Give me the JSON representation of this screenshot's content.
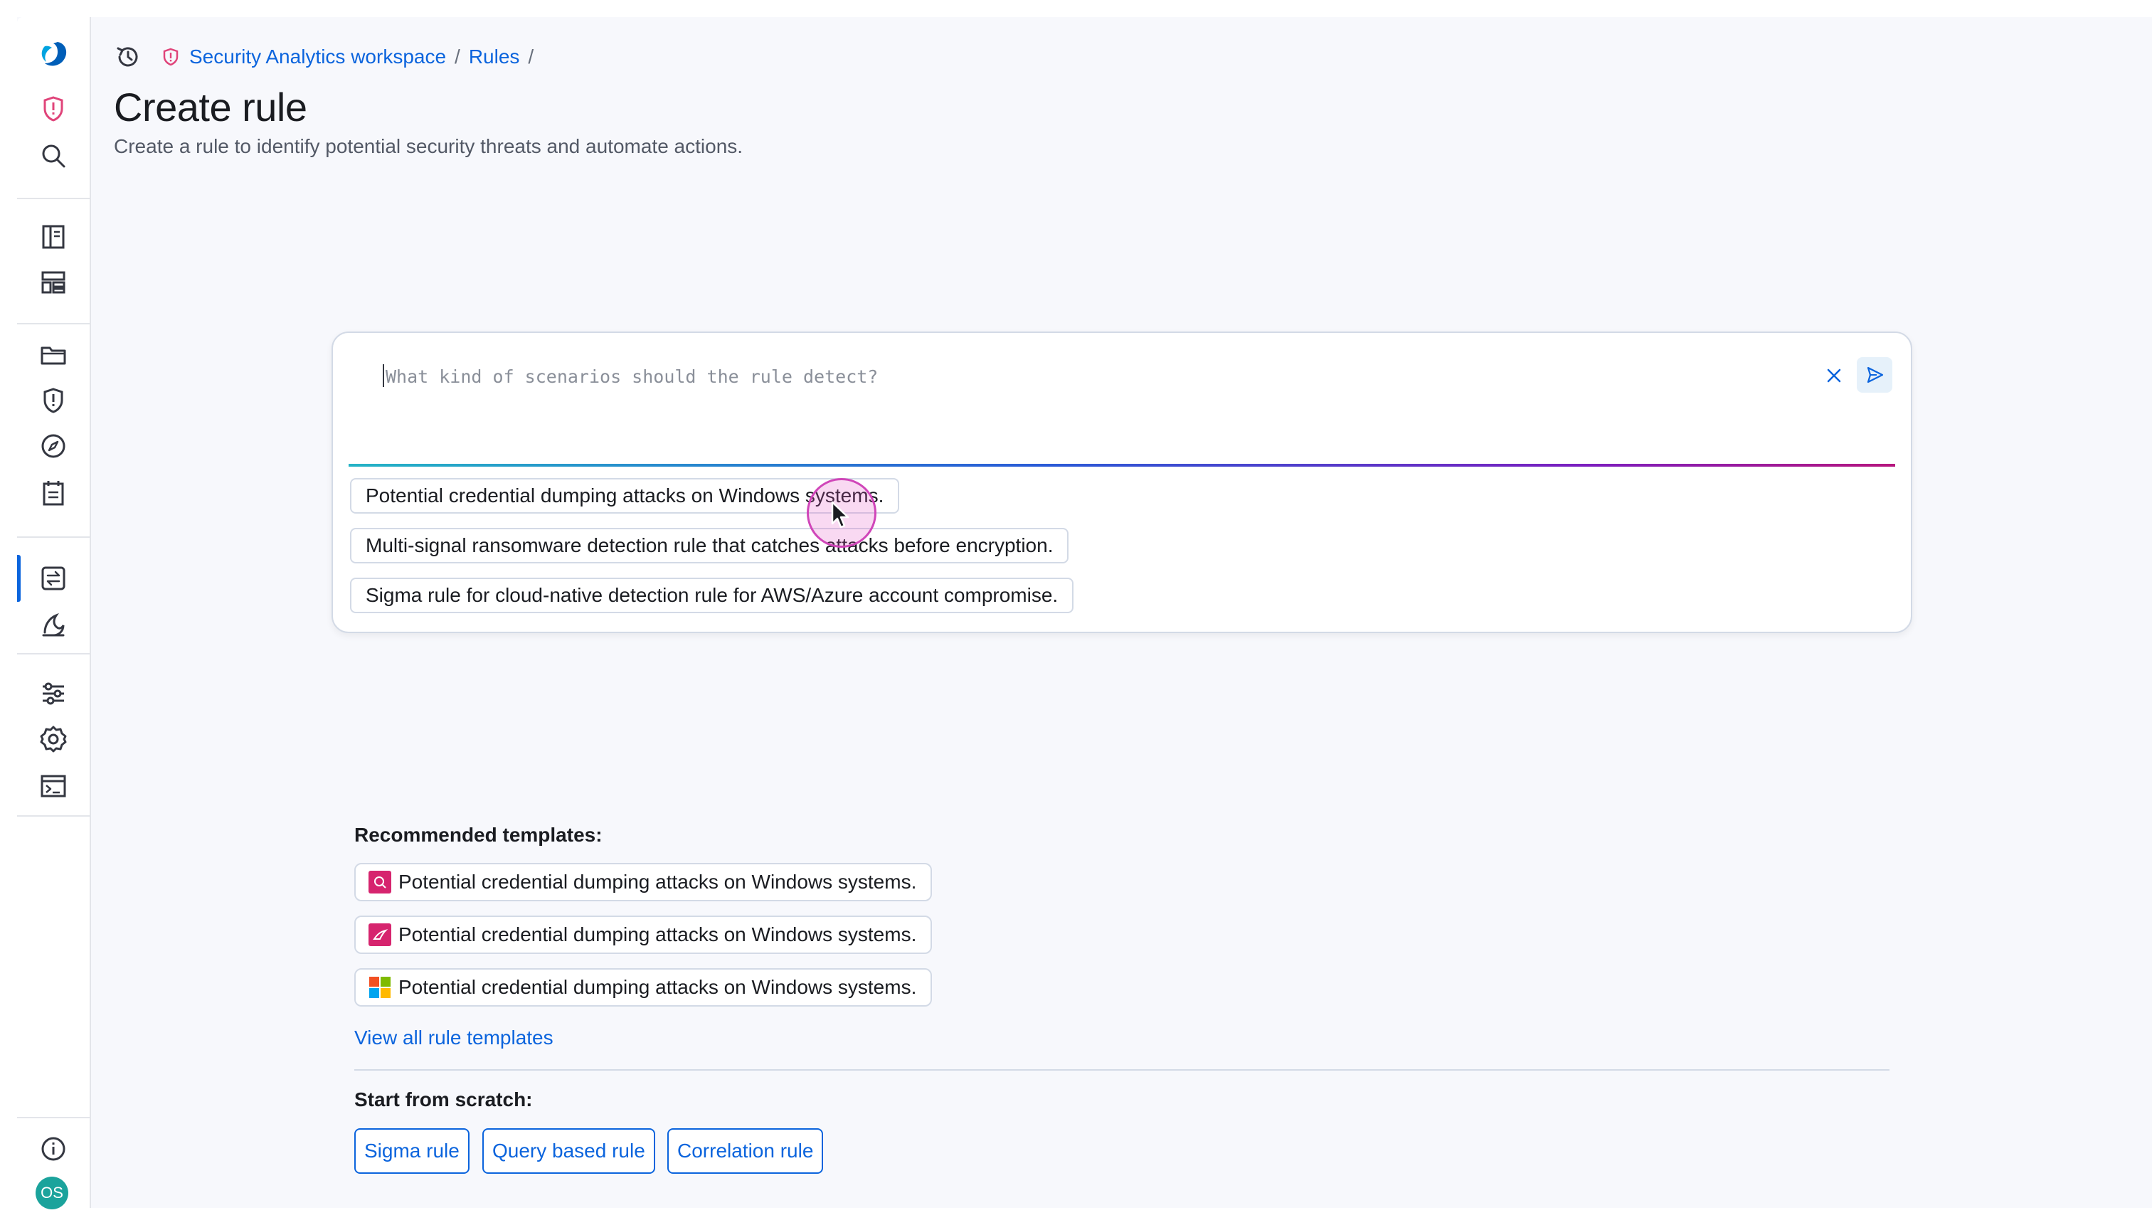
{
  "header": {
    "breadcrumbs": [
      {
        "label": "Security Analytics workspace"
      },
      {
        "label": "Rules"
      }
    ],
    "separator": "/",
    "title": "Create rule",
    "subtitle": "Create a rule to identify potential security threats and automate actions."
  },
  "prompt": {
    "placeholder": "What kind of scenarios should the rule detect?",
    "value": "",
    "suggestions": [
      "Potential credential dumping attacks on Windows systems.",
      "Multi-signal ransomware detection rule that catches attacks before encryption.",
      "Sigma rule for cloud-native detection rule for AWS/Azure account compromise."
    ]
  },
  "templates": {
    "heading": "Recommended templates:",
    "items": [
      {
        "label": "Potential credential dumping attacks on Windows systems.",
        "logo_icon": "pink-integration-logo-icon",
        "logo_color": "#d6246e"
      },
      {
        "label": "Potential credential dumping attacks on Windows systems.",
        "logo_icon": "pink-integration-logo-icon",
        "logo_color": "#d6246e"
      },
      {
        "label": "Potential credential dumping attacks on Windows systems.",
        "logo_icon": "windows-logo-icon",
        "logo_color": "#00a4ef"
      }
    ],
    "view_all": "View all rule templates"
  },
  "scratch": {
    "heading": "Start from scratch:",
    "buttons": [
      "Sigma rule",
      "Query based rule",
      "Correlation rule"
    ]
  },
  "sidebar": {
    "items": [
      "opensearch-logo-icon",
      "security-shield-icon",
      "search-icon",
      "notebook-icon",
      "dashboard-layout-icon",
      "folder-icon",
      "alert-shield-icon",
      "discover-compass-icon",
      "clipboard-icon",
      "rules-transform-icon",
      "threat-intel-icon",
      "sliders-icon",
      "settings-gear-icon",
      "dev-tools-console-icon",
      "help-info-icon"
    ],
    "avatar_initials": "OS"
  },
  "colors": {
    "accent": "#0b64dd",
    "brand_pink": "#e0447a",
    "avatar": "#1ba39c"
  }
}
